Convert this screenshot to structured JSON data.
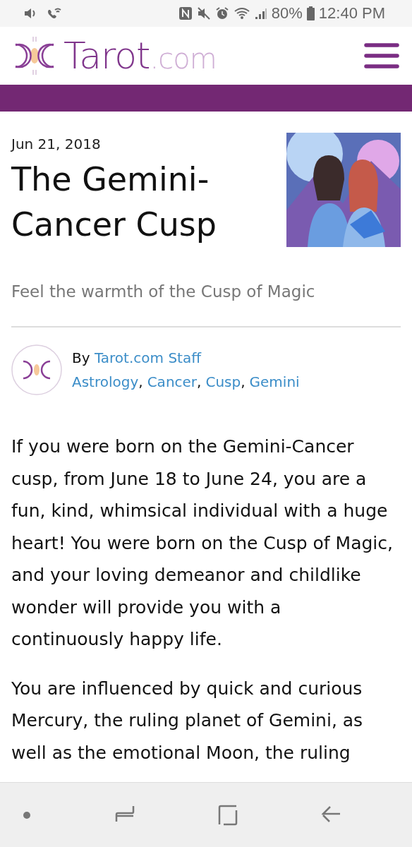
{
  "status_bar": {
    "battery": "80%",
    "time": "12:40 PM"
  },
  "header": {
    "logo": {
      "name": "Tarot",
      "suffix": ".com"
    }
  },
  "article": {
    "date": "Jun 21, 2018",
    "title": "The Gemini-Cancer Cusp",
    "subtitle": "Feel the warmth of the Cusp of Magic",
    "author": {
      "prefix": "By",
      "name": "Tarot.com Staff"
    },
    "tags": [
      "Astrology",
      "Cancer",
      "Cusp",
      "Gemini"
    ],
    "tag_separator": ",",
    "paragraphs": [
      "If you were born on the Gemini-Cancer cusp, from June 18 to June 24, you are a fun, kind, whimsical individual with a huge heart! You were born on the Cusp of Magic, and your loving demeanor and childlike wonder will provide you with a continuously happy life.",
      "You are influenced by quick and curious Mercury, the ruling planet of Gemini, as well as the emotional Moon, the ruling"
    ]
  }
}
